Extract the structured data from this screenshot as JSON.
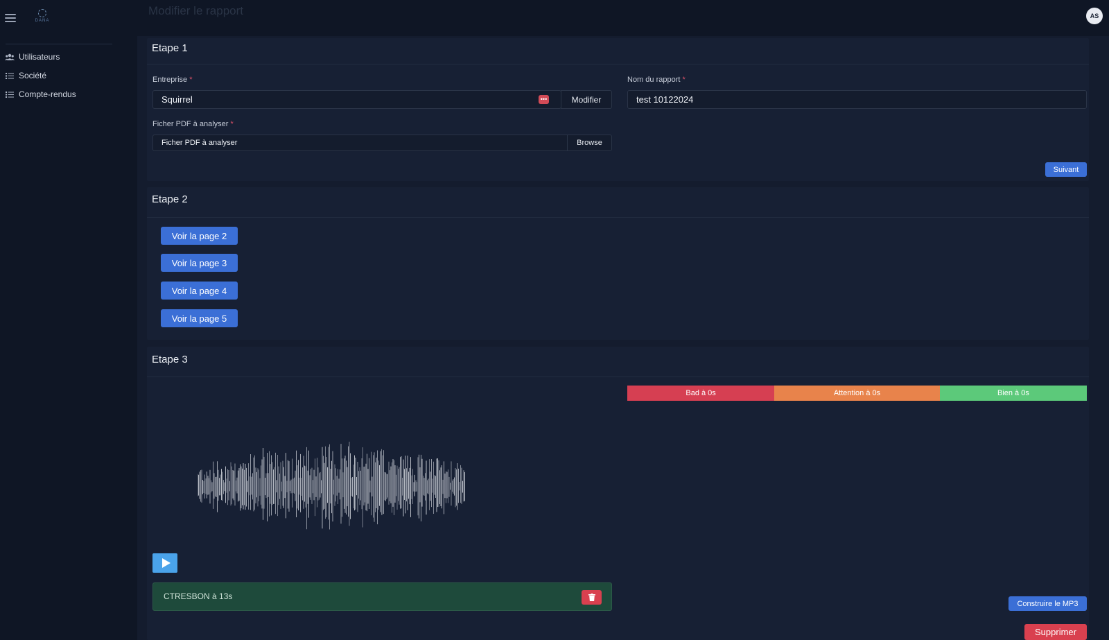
{
  "app": {
    "logo_text": "DANA",
    "page_title": "Modifier le rapport",
    "avatar_initials": "AS"
  },
  "sidebar": {
    "items": [
      {
        "label": "Utilisateurs",
        "icon": "users-icon"
      },
      {
        "label": "Société",
        "icon": "list-icon"
      },
      {
        "label": "Compte-rendus",
        "icon": "list-icon"
      }
    ]
  },
  "step1": {
    "title": "Etape 1",
    "company_label": "Entreprise",
    "company_value": "Squirrel",
    "modify_label": "Modifier",
    "report_name_label": "Nom du rapport",
    "report_name_value": "test 10122024",
    "pdf_label": "Ficher PDF à analyser",
    "pdf_placeholder": "Ficher PDF à analyser",
    "browse_label": "Browse",
    "next_label": "Suivant",
    "required_mark": "*"
  },
  "step2": {
    "title": "Etape 2",
    "page_buttons": [
      "Voir la page 2",
      "Voir la page 3",
      "Voir la page 4",
      "Voir la page 5"
    ]
  },
  "step3": {
    "title": "Etape 3",
    "status": [
      {
        "label": "Bad à 0s",
        "color": "#d63f52",
        "fraction": 0.32
      },
      {
        "label": "Attention à 0s",
        "color": "#e8834b",
        "fraction": 0.36
      },
      {
        "label": "Bien à 0s",
        "color": "#5cc97a",
        "fraction": 0.32
      }
    ],
    "marker_text": "CTRESBON à 13s",
    "build_mp3_label": "Construire le MP3",
    "delete_label": "Supprimer"
  },
  "colors": {
    "accent": "#3b6fd6",
    "danger": "#d9404f",
    "play": "#4aa3ea",
    "background": "#141c2e"
  }
}
